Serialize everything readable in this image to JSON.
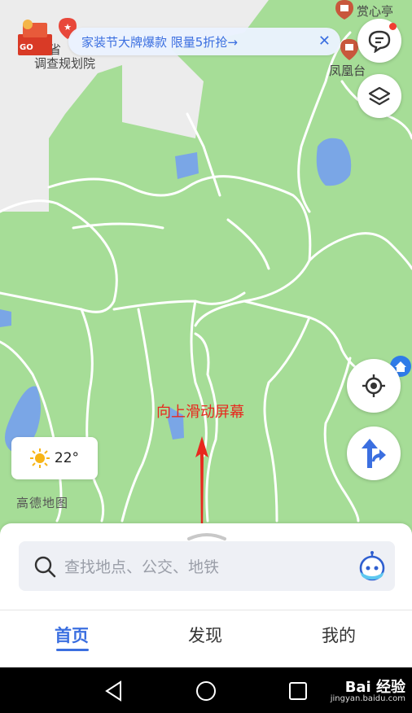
{
  "map": {
    "poi_top_right": "赏心亭",
    "poi_right": "凤凰台",
    "poi_left_line1": "东省",
    "poi_left_line2": "调查规划院",
    "badge_go": "GO",
    "brand_label": "高德地图"
  },
  "banner": {
    "text": "家装节大牌爆款 限量5折抢→",
    "close_symbol": "✕"
  },
  "weather": {
    "temperature": "22°"
  },
  "annotation": {
    "hint_text": "向上滑动屏幕"
  },
  "search": {
    "placeholder": "查找地点、公交、地铁"
  },
  "tabs": [
    {
      "label": "首页",
      "active": true
    },
    {
      "label": "发现",
      "active": false
    },
    {
      "label": "我的",
      "active": false
    }
  ],
  "watermark": {
    "logo_text": "Bai 经验",
    "url_text": "jingyan.baidu.com"
  },
  "colors": {
    "map_green": "#a6dd97",
    "accent_blue": "#3b6fe0",
    "hint_red": "#e8281e"
  }
}
